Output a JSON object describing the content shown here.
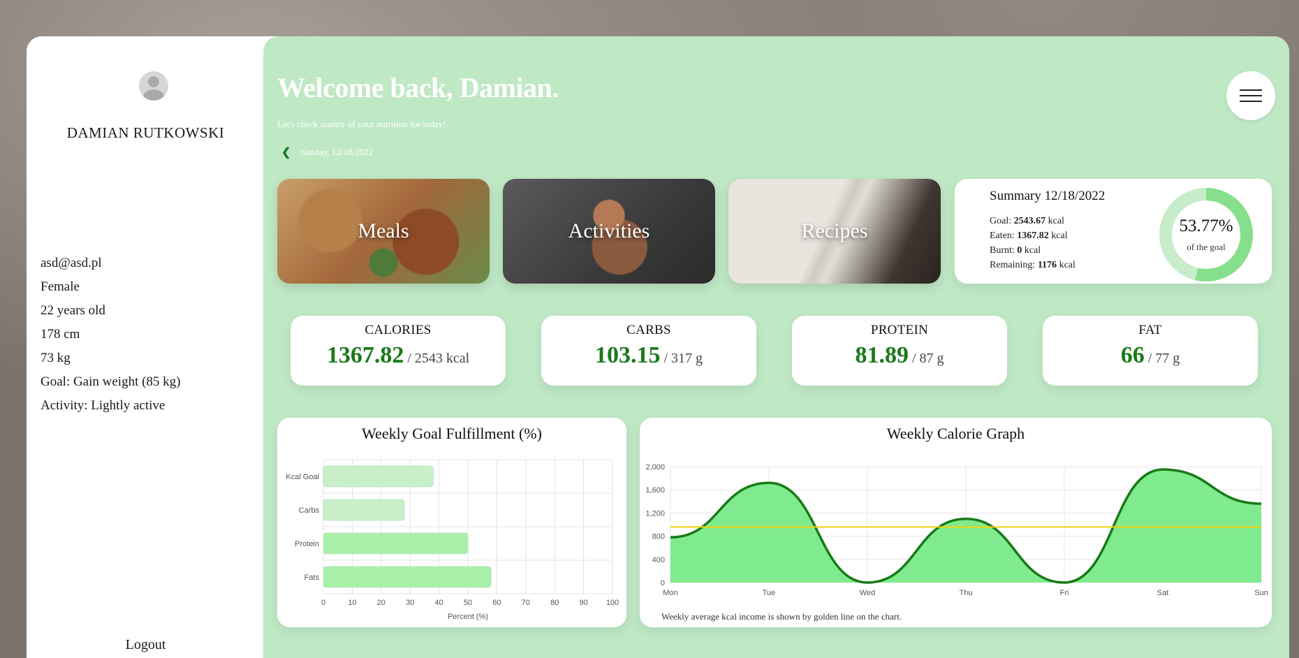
{
  "profile": {
    "name": "DAMIAN RUTKOWSKI",
    "email": "asd@asd.pl",
    "gender": "Female",
    "age": "22 years old",
    "height": "178 cm",
    "weight": "73 kg",
    "goal": "Goal: Gain weight (85 kg)",
    "activity": "Activity: Lightly active",
    "logout_label": "Logout"
  },
  "header": {
    "welcome": "Welcome back, Damian.",
    "subtitle": "Let's check quality of your nutrition for today!",
    "date": "Sunday, 12/18/2022"
  },
  "tiles": {
    "meals": "Meals",
    "activities": "Activities",
    "recipes": "Recipes"
  },
  "summary": {
    "title": "Summary 12/18/2022",
    "goal_label": "Goal:",
    "goal_value": "2543.67",
    "eaten_label": "Eaten:",
    "eaten_value": "1367.82",
    "burnt_label": "Burnt:",
    "burnt_value": "0",
    "remaining_label": "Remaining:",
    "remaining_value": "1176",
    "unit": "kcal",
    "percent": "53.77%",
    "percent_value": 53.77,
    "percent_caption": "of the goal"
  },
  "macros": [
    {
      "title": "CALORIES",
      "value": "1367.82",
      "target": "/ 2543 kcal"
    },
    {
      "title": "CARBS",
      "value": "103.15",
      "target": "/ 317 g"
    },
    {
      "title": "PROTEIN",
      "value": "81.89",
      "target": "/ 87 g"
    },
    {
      "title": "FAT",
      "value": "66",
      "target": "/ 77 g"
    }
  ],
  "colors": {
    "main_bg": "#bfe8c5",
    "accent_green": "#1a7a1a",
    "bar_green": "#a8f0a8",
    "area_fill": "#80ea8e",
    "line_dark": "#177a17",
    "avg_line": "#f5d20a"
  },
  "chart_data": [
    {
      "type": "bar",
      "orientation": "horizontal",
      "title": "Weekly Goal Fulfillment (%)",
      "categories": [
        "Kcal Goal",
        "Carbs",
        "Protein",
        "Fats"
      ],
      "values": [
        38,
        28,
        50,
        58
      ],
      "xlabel": "Percent (%)",
      "ylabel": "",
      "xlim": [
        0,
        100
      ],
      "xticks": [
        0,
        10,
        20,
        30,
        40,
        50,
        60,
        70,
        80,
        90,
        100
      ],
      "grid": true
    },
    {
      "type": "area",
      "title": "Weekly Calorie Graph",
      "categories": [
        "Mon",
        "Tue",
        "Wed",
        "Thu",
        "Fri",
        "Sat",
        "Sun"
      ],
      "values": [
        780,
        1720,
        0,
        1100,
        0,
        1950,
        1360
      ],
      "average": 960,
      "ylim": [
        0,
        2000
      ],
      "yticks": [
        "0",
        "400",
        "800",
        "1,200",
        "1,600",
        "2,000"
      ],
      "ytick_values": [
        0,
        400,
        800,
        1200,
        1600,
        2000
      ],
      "grid": true,
      "footnote": "Weekly average kcal income is shown by golden line on the chart."
    }
  ]
}
